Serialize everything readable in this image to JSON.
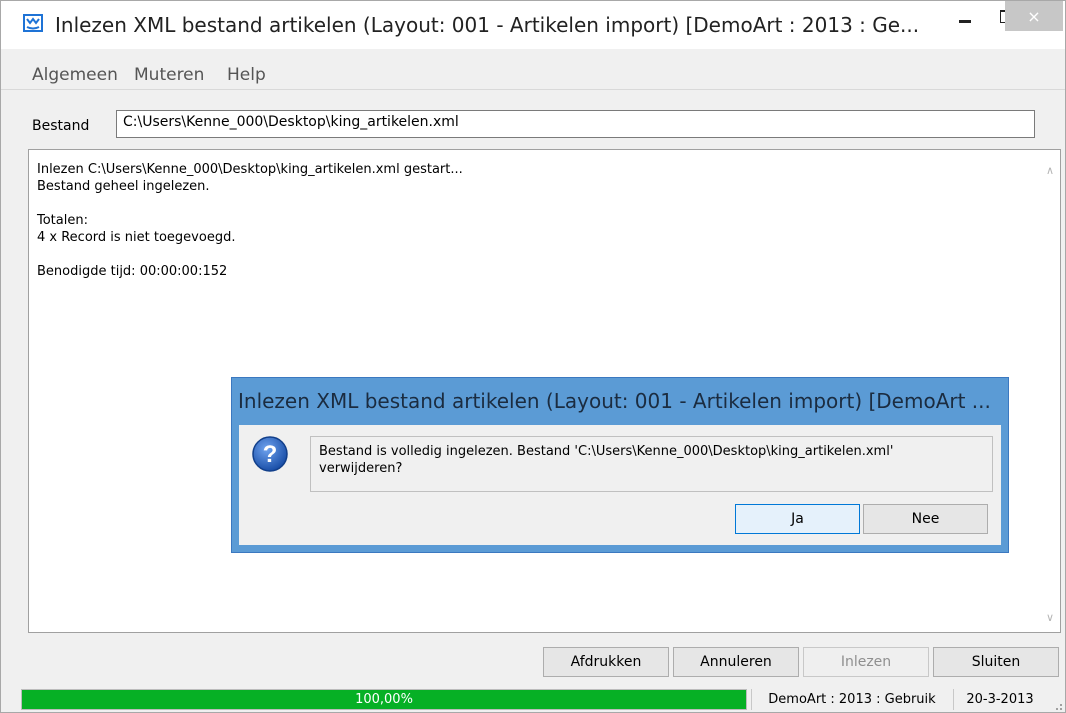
{
  "window": {
    "title": "Inlezen XML bestand artikelen (Layout: 001 - Artikelen import)  [DemoArt : 2013 : Ge...",
    "min_icon": "minimize-icon",
    "max_icon": "maximize-icon",
    "close_symbol": "×"
  },
  "menu": {
    "items": [
      "Algemeen",
      "Muteren",
      "Help"
    ]
  },
  "bestand": {
    "label": "Bestand",
    "value": "C:\\Users\\Kenne_000\\Desktop\\king_artikelen.xml"
  },
  "log": {
    "lines": [
      "Inlezen C:\\Users\\Kenne_000\\Desktop\\king_artikelen.xml gestart...",
      "Bestand geheel ingelezen.",
      "Totalen:",
      "4 x Record is niet toegevoegd.",
      "Benodigde tijd: 00:00:00:152"
    ],
    "scroll_up": "∧",
    "scroll_down": "∨"
  },
  "buttons": {
    "afdrukken": "Afdrukken",
    "annuleren": "Annuleren",
    "inlezen": "Inlezen",
    "sluiten": "Sluiten"
  },
  "status": {
    "progress_text": "100,00%",
    "progress_fraction": 1.0,
    "administration": "DemoArt : 2013 : Gebruik",
    "date": "20-3-2013"
  },
  "dialog": {
    "title": "Inlezen XML bestand artikelen (Layout: 001 - Artikelen import)  [DemoArt ...",
    "icon": "question-icon",
    "message_line1": "Bestand is volledig ingelezen. Bestand 'C:\\Users\\Kenne_000\\Desktop\\king_artikelen.xml'",
    "message_line2": "verwijderen?",
    "yes": "Ja",
    "no": "Nee"
  },
  "colors": {
    "progress": "#06b025",
    "dialog_frame": "#5b9bd5",
    "app_icon": "#1e73d6"
  }
}
